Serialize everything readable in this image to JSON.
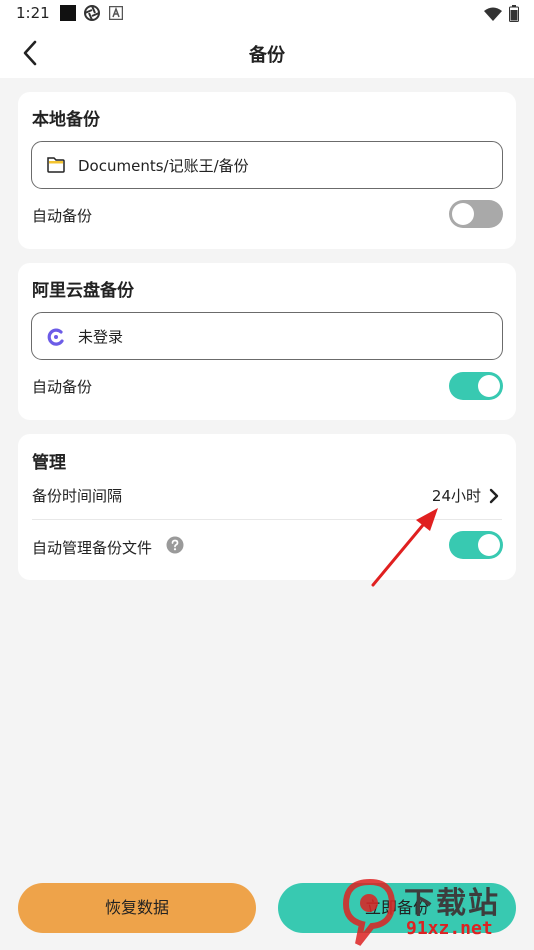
{
  "status_bar": {
    "time": "1:21"
  },
  "header": {
    "title": "备份"
  },
  "local_backup": {
    "title": "本地备份",
    "path": "Documents/记账王/备份",
    "auto_label": "自动备份",
    "auto_enabled": false
  },
  "aliyun_backup": {
    "title": "阿里云盘备份",
    "account": "未登录",
    "auto_label": "自动备份",
    "auto_enabled": true
  },
  "management": {
    "title": "管理",
    "interval_label": "备份时间间隔",
    "interval_value": "24小时",
    "auto_manage_label": "自动管理备份文件",
    "auto_manage_enabled": true
  },
  "actions": {
    "restore_label": "恢复数据",
    "backup_now_label": "立即备份"
  },
  "watermark": {
    "text_cn": "下载站",
    "text_url": "91xz.net"
  },
  "colors": {
    "accent_green": "#38c9b1",
    "accent_orange": "#eea34a",
    "toggle_off": "#a9a9a9"
  }
}
